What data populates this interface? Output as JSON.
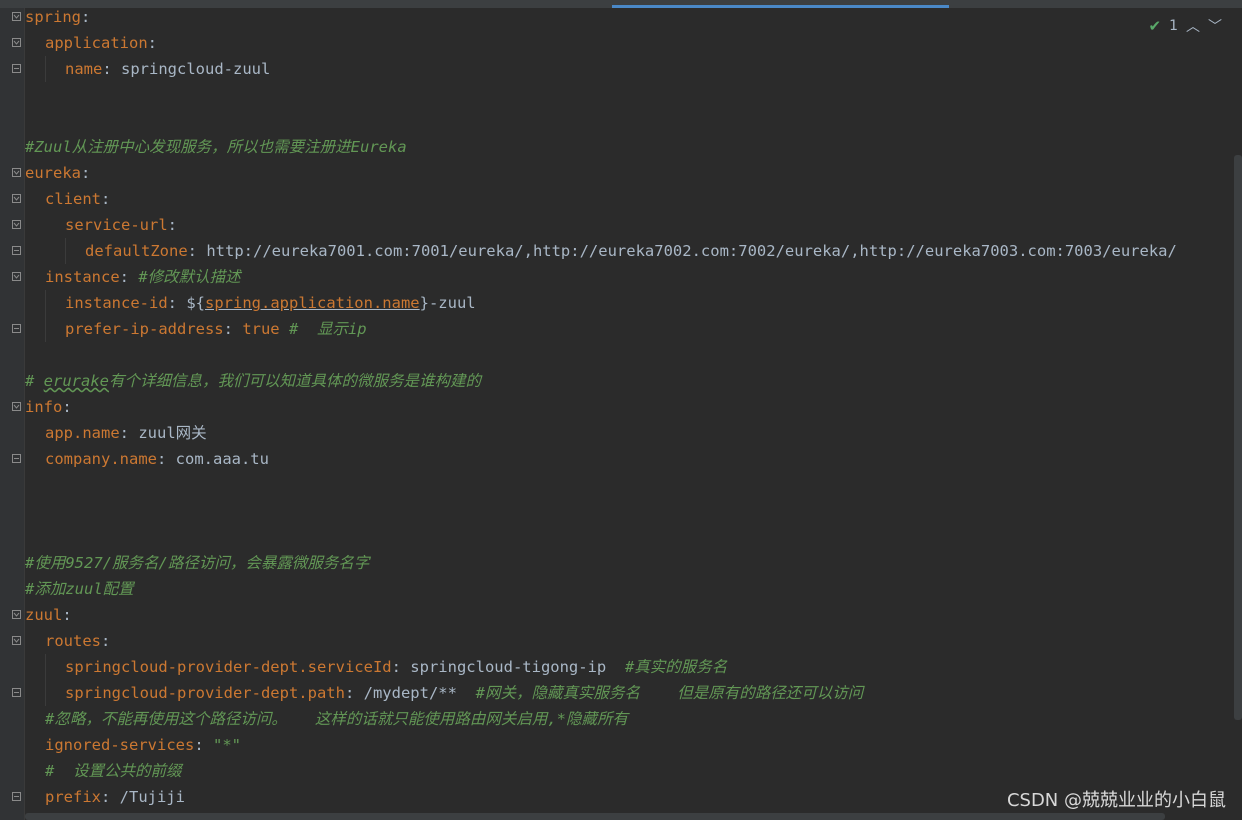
{
  "editor": {
    "lines": {
      "l1": {
        "key": "spring",
        "colon": ":"
      },
      "l2": {
        "key": "application",
        "colon": ":"
      },
      "l3": {
        "key": "name",
        "colon": ": ",
        "value": "springcloud-zuul"
      },
      "l6": {
        "comment": "#Zuul从注册中心发现服务，所以也需要注册进Eureka"
      },
      "l7": {
        "key": "eureka",
        "colon": ":"
      },
      "l8": {
        "key": "client",
        "colon": ":"
      },
      "l9": {
        "key": "service-url",
        "colon": ":"
      },
      "l10": {
        "key": "defaultZone",
        "colon": ": ",
        "value": "http://eureka7001.com:7001/eureka/,http://eureka7002.com:7002/eureka/,http://eureka7003.com:7003/eureka/"
      },
      "l11": {
        "key": "instance",
        "colon": ": ",
        "comment": "#修改默认描述"
      },
      "l12": {
        "key": "instance-id",
        "colon": ": ",
        "prefix": "${",
        "ref": "spring.application.name",
        "suffix": "}-zuul"
      },
      "l13": {
        "key": "prefer-ip-address",
        "colon": ": ",
        "value": "true",
        "comment": "#  显示ip"
      },
      "l15": {
        "comment_prefix": "# ",
        "comment_word": "erurake",
        "comment_rest": "有个详细信息，我们可以知道具体的微服务是谁构建的"
      },
      "l16": {
        "key": "info",
        "colon": ":"
      },
      "l17": {
        "key": "app.name",
        "colon": ": ",
        "value": "zuul网关"
      },
      "l18": {
        "key": "company.name",
        "colon": ": ",
        "value": "com.aaa.tu"
      },
      "l22": {
        "comment": "#使用9527/服务名/路径访问，会暴露微服务名字"
      },
      "l23": {
        "comment": "#添加zuul配置"
      },
      "l24": {
        "key": "zuul",
        "colon": ":"
      },
      "l25": {
        "key": "routes",
        "colon": ":"
      },
      "l26": {
        "key": "springcloud-provider-dept.serviceId",
        "colon": ": ",
        "value": "springcloud-tigong-ip",
        "comment": "#真实的服务名"
      },
      "l27": {
        "key": "springcloud-provider-dept.path",
        "colon": ": ",
        "value": "/mydept/**",
        "comment": "#网关，隐藏真实服务名    但是原有的路径还可以访问"
      },
      "l28": {
        "comment": "#忽略，不能再使用这个路径访问。   这样的话就只能使用路由网关启用,*隐藏所有"
      },
      "l29": {
        "key": "ignored-services",
        "colon": ": ",
        "value": "\"*\""
      },
      "l30": {
        "comment": "#  设置公共的前缀"
      },
      "l31": {
        "key": "prefix",
        "colon": ": ",
        "value": "/Tujiji"
      }
    }
  },
  "inspection": {
    "count": "1",
    "up_icon": "chevron-up-icon",
    "down_icon": "chevron-down-icon"
  },
  "watermark": "CSDN @兢兢业业的小白鼠",
  "colors": {
    "background": "#2b2b2b",
    "key": "#cc7832",
    "text": "#a9b7c6",
    "comment": "#629755",
    "tab_accent": "#4a88c7"
  }
}
